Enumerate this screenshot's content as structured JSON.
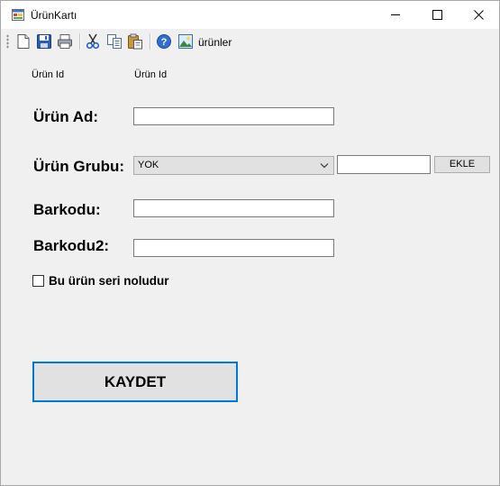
{
  "window": {
    "title": "ÜrünKartı",
    "minimize_icon": "minimize-icon",
    "maximize_icon": "maximize-icon",
    "close_icon": "close-icon"
  },
  "toolbar": {
    "items": [
      "new-file-icon",
      "save-icon",
      "print-icon",
      "cut-icon",
      "copy-icon",
      "paste-icon",
      "help-icon",
      "image-icon"
    ],
    "urunler_label": "ürünler"
  },
  "form": {
    "urun_id_label": "Ürün Id",
    "urun_id_value": "Ürün Id",
    "urun_ad_label": "Ürün Ad:",
    "urun_ad_value": "",
    "urun_grubu_label": "Ürün Grubu:",
    "urun_grubu_selected": "YOK",
    "new_group_value": "",
    "ekle_label": "EKLE",
    "barkodu_label": "Barkodu:",
    "barkodu_value": "",
    "barkodu2_label": "Barkodu2:",
    "barkodu2_value": "",
    "seri_checkbox_label": "Bu ürün seri noludur",
    "seri_checked": false,
    "kaydet_label": "KAYDET"
  },
  "colors": {
    "accent_border": "#0078d7",
    "button_face": "#e1e1e1",
    "window_bg": "#f0f0f0"
  }
}
